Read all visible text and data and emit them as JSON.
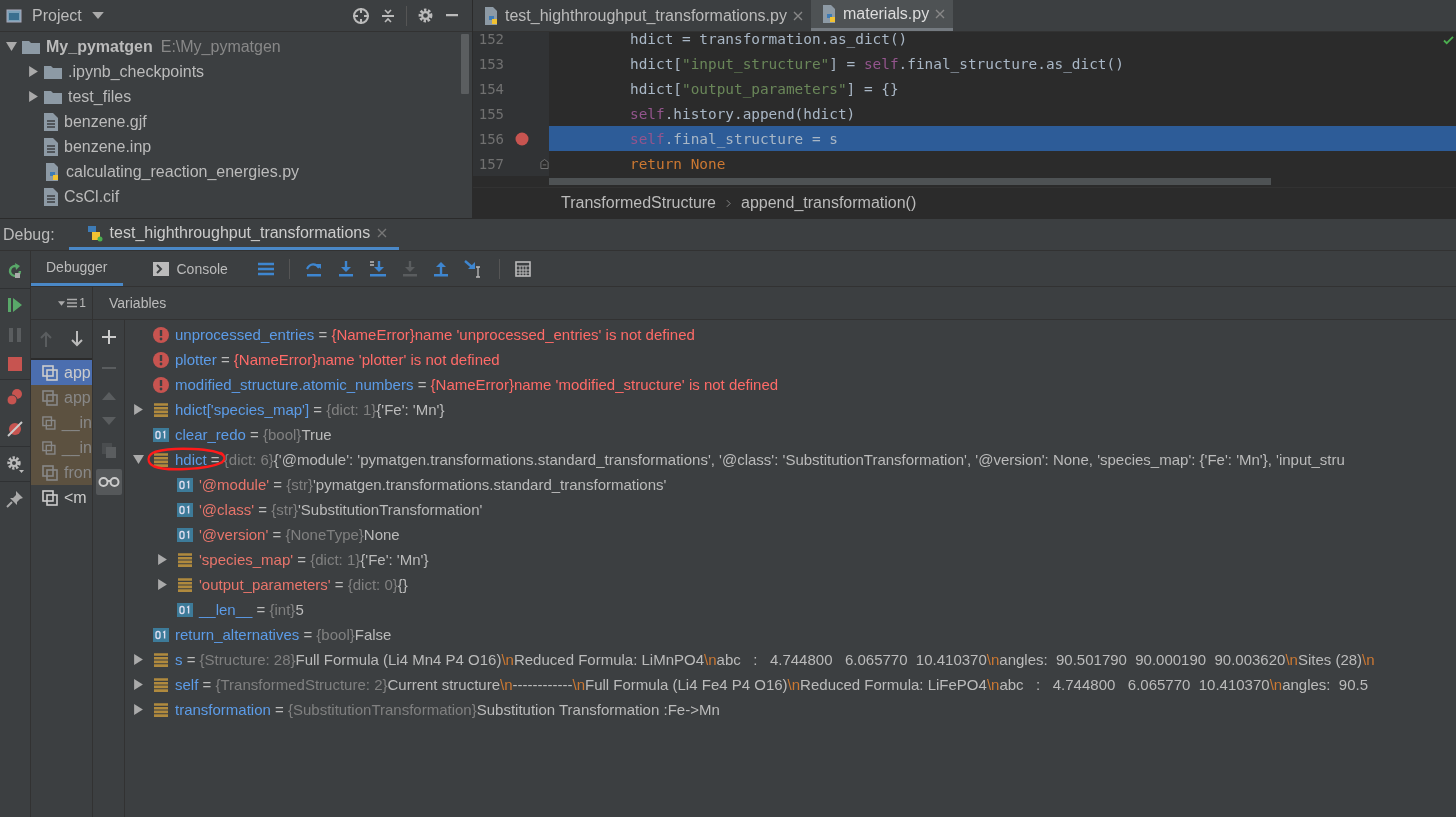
{
  "project_panel": {
    "title": "Project",
    "tree": [
      {
        "name": "My_pymatgen",
        "path": "E:\\My_pymatgen",
        "kind": "root",
        "expanded": true,
        "children": [
          {
            "name": ".ipynb_checkpoints",
            "kind": "folder",
            "expanded": false
          },
          {
            "name": "test_files",
            "kind": "folder",
            "expanded": false
          },
          {
            "name": "benzene.gjf",
            "kind": "file"
          },
          {
            "name": "benzene.inp",
            "kind": "file"
          },
          {
            "name": "calculating_reaction_energies.py",
            "kind": "python"
          },
          {
            "name": "CsCl.cif",
            "kind": "file"
          }
        ]
      }
    ]
  },
  "editor": {
    "tabs": [
      {
        "label": "test_highthroughput_transformations.py",
        "selected": false
      },
      {
        "label": "materials.py",
        "selected": true
      }
    ],
    "lines": [
      {
        "number": "152",
        "breakpoint": false,
        "current": false,
        "fold": false,
        "tokens": [
          {
            "text": "hdict = transformation.as_dict()",
            "kind": "plain"
          }
        ]
      },
      {
        "number": "153",
        "breakpoint": false,
        "current": false,
        "fold": false,
        "tokens": [
          {
            "text": "hdict[",
            "kind": "plain"
          },
          {
            "text": "\"input_structure\"",
            "kind": "string"
          },
          {
            "text": "] = ",
            "kind": "plain"
          },
          {
            "text": "self",
            "kind": "self"
          },
          {
            "text": ".final_structure.as_dict()",
            "kind": "plain"
          }
        ]
      },
      {
        "number": "154",
        "breakpoint": false,
        "current": false,
        "fold": false,
        "tokens": [
          {
            "text": "hdict[",
            "kind": "plain"
          },
          {
            "text": "\"output_parameters\"",
            "kind": "string"
          },
          {
            "text": "] = {}",
            "kind": "plain"
          }
        ]
      },
      {
        "number": "155",
        "breakpoint": false,
        "current": false,
        "fold": false,
        "tokens": [
          {
            "text": "self",
            "kind": "self"
          },
          {
            "text": ".history.append(hdict)",
            "kind": "plain"
          }
        ]
      },
      {
        "number": "156",
        "breakpoint": true,
        "current": true,
        "fold": false,
        "tokens": [
          {
            "text": "self",
            "kind": "self"
          },
          {
            "text": ".final_structure = s",
            "kind": "plain"
          }
        ]
      },
      {
        "number": "157",
        "breakpoint": false,
        "current": false,
        "fold": true,
        "tokens": [
          {
            "text": "return ",
            "kind": "keyword"
          },
          {
            "text": "None",
            "kind": "keyword"
          }
        ]
      }
    ],
    "breadcrumbs": [
      "TransformedStructure",
      "append_transformation()"
    ]
  },
  "debug": {
    "label": "Debug:",
    "session_tab": "test_highthroughput_transformations",
    "tabs": [
      {
        "label": "Debugger",
        "selected": true
      },
      {
        "label": "Console",
        "selected": false
      }
    ],
    "thread_selector": "1",
    "frames": [
      {
        "label": "app",
        "selected": true,
        "library": false
      },
      {
        "label": "app",
        "selected": false,
        "library": true
      },
      {
        "label": "__in",
        "selected": false,
        "library": true
      },
      {
        "label": "__in",
        "selected": false,
        "library": true
      },
      {
        "label": "fron",
        "selected": false,
        "library": true
      },
      {
        "label": "<m",
        "selected": false,
        "library": false
      }
    ],
    "variables_title": "Variables",
    "variables": [
      {
        "name": {
          "text": "unprocessed_entries",
          "kind": "identifier"
        },
        "operator": "=",
        "kind": "error",
        "parts": [
          {
            "text": "{NameError}name 'unprocessed_entries' is not defined",
            "kind": "error"
          }
        ]
      },
      {
        "name": {
          "text": "plotter",
          "kind": "identifier"
        },
        "operator": "=",
        "kind": "error",
        "parts": [
          {
            "text": "{NameError}name 'plotter' is not defined",
            "kind": "error"
          }
        ]
      },
      {
        "name": {
          "text": "modified_structure.atomic_numbers",
          "kind": "identifier"
        },
        "operator": "=",
        "kind": "error",
        "parts": [
          {
            "text": "{NameError}name 'modified_structure' is not defined",
            "kind": "error"
          }
        ]
      },
      {
        "name": {
          "text": "hdict['species_map']",
          "kind": "identifier"
        },
        "operator": "=",
        "kind": "collection",
        "expanded": false,
        "parts": [
          {
            "text": "{dict: 1}",
            "kind": "type"
          },
          {
            "text": "{'Fe': 'Mn'}",
            "kind": "text"
          }
        ]
      },
      {
        "name": {
          "text": "clear_redo",
          "kind": "identifier"
        },
        "operator": "=",
        "kind": "scalar",
        "parts": [
          {
            "text": "{bool}",
            "kind": "type"
          },
          {
            "text": "True",
            "kind": "text"
          }
        ]
      },
      {
        "name": {
          "text": "hdict",
          "kind": "identifier"
        },
        "operator": "=",
        "kind": "collection",
        "expanded": true,
        "annotated": true,
        "parts": [
          {
            "text": "{dict: 6}",
            "kind": "type"
          },
          {
            "text": "{'@module': 'pymatgen.transformations.standard_transformations', '@class': 'SubstitutionTransformation', '@version': None, 'species_map': {'Fe': 'Mn'}, 'input_stru",
            "kind": "text"
          }
        ],
        "children": [
          {
            "name": {
              "text": "'@module'",
              "kind": "string"
            },
            "operator": "=",
            "kind": "scalar",
            "parts": [
              {
                "text": "{str}",
                "kind": "type"
              },
              {
                "text": "'pymatgen.transformations.standard_transformations'",
                "kind": "text"
              }
            ]
          },
          {
            "name": {
              "text": "'@class'",
              "kind": "string"
            },
            "operator": "=",
            "kind": "scalar",
            "parts": [
              {
                "text": "{str}",
                "kind": "type"
              },
              {
                "text": "'SubstitutionTransformation'",
                "kind": "text"
              }
            ]
          },
          {
            "name": {
              "text": "'@version'",
              "kind": "string"
            },
            "operator": "=",
            "kind": "scalar",
            "parts": [
              {
                "text": "{NoneType}",
                "kind": "type"
              },
              {
                "text": "None",
                "kind": "text"
              }
            ]
          },
          {
            "name": {
              "text": "'species_map'",
              "kind": "string"
            },
            "operator": "=",
            "kind": "collection",
            "expanded": false,
            "parts": [
              {
                "text": "{dict: 1}",
                "kind": "type"
              },
              {
                "text": "{'Fe': 'Mn'}",
                "kind": "text"
              }
            ]
          },
          {
            "name": {
              "text": "'output_parameters'",
              "kind": "string"
            },
            "operator": "=",
            "kind": "collection",
            "expanded": false,
            "parts": [
              {
                "text": "{dict: 0}",
                "kind": "type"
              },
              {
                "text": "{}",
                "kind": "text"
              }
            ]
          },
          {
            "name": {
              "text": "__len__",
              "kind": "identifier"
            },
            "operator": "=",
            "kind": "scalar",
            "parts": [
              {
                "text": "{int}",
                "kind": "type"
              },
              {
                "text": "5",
                "kind": "text"
              }
            ]
          }
        ]
      },
      {
        "name": {
          "text": "return_alternatives",
          "kind": "identifier"
        },
        "operator": "=",
        "kind": "scalar",
        "parts": [
          {
            "text": "{bool}",
            "kind": "type"
          },
          {
            "text": "False",
            "kind": "text"
          }
        ]
      },
      {
        "name": {
          "text": "s",
          "kind": "identifier"
        },
        "operator": "=",
        "kind": "collection",
        "expanded": false,
        "parts": [
          {
            "text": "{Structure: 28}",
            "kind": "type"
          },
          {
            "text": "Full Formula (Li4 Mn4 P4 O16)",
            "kind": "text"
          },
          {
            "text": "\\n",
            "kind": "escape"
          },
          {
            "text": "Reduced Formula: LiMnPO4",
            "kind": "text"
          },
          {
            "text": "\\n",
            "kind": "escape"
          },
          {
            "text": "abc   :   4.744800   6.065770  10.410370",
            "kind": "text"
          },
          {
            "text": "\\n",
            "kind": "escape"
          },
          {
            "text": "angles:  90.501790  90.000190  90.003620",
            "kind": "text"
          },
          {
            "text": "\\n",
            "kind": "escape"
          },
          {
            "text": "Sites (28)",
            "kind": "text"
          },
          {
            "text": "\\n",
            "kind": "escape"
          }
        ]
      },
      {
        "name": {
          "text": "self",
          "kind": "identifier"
        },
        "operator": "=",
        "kind": "collection",
        "expanded": false,
        "parts": [
          {
            "text": "{TransformedStructure: 2}",
            "kind": "type"
          },
          {
            "text": "Current structure",
            "kind": "text"
          },
          {
            "text": "\\n",
            "kind": "escape"
          },
          {
            "text": "------------",
            "kind": "text"
          },
          {
            "text": "\\n",
            "kind": "escape"
          },
          {
            "text": "Full Formula (Li4 Fe4 P4 O16)",
            "kind": "text"
          },
          {
            "text": "\\n",
            "kind": "escape"
          },
          {
            "text": "Reduced Formula: LiFePO4",
            "kind": "text"
          },
          {
            "text": "\\n",
            "kind": "escape"
          },
          {
            "text": "abc   :   4.744800   6.065770  10.410370",
            "kind": "text"
          },
          {
            "text": "\\n",
            "kind": "escape"
          },
          {
            "text": "angles:  90.5",
            "kind": "text"
          }
        ]
      },
      {
        "name": {
          "text": "transformation",
          "kind": "identifier"
        },
        "operator": "=",
        "kind": "collection",
        "expanded": false,
        "parts": [
          {
            "text": "{SubstitutionTransformation}",
            "kind": "type"
          },
          {
            "text": "Substitution Transformation :Fe->Mn",
            "kind": "text"
          }
        ]
      }
    ]
  }
}
